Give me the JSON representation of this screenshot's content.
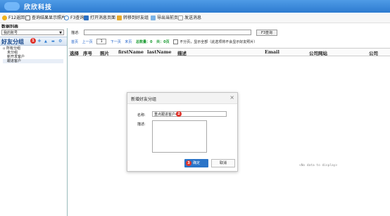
{
  "window": {
    "title": "欣欣科技"
  },
  "toolbar": {
    "items": [
      {
        "label": "F12返回",
        "icon": "smiley-icon",
        "color": "#f0b21c"
      },
      {
        "label": "查询结果显示照片",
        "icon": "checkbox-icon",
        "color": "#ffffff"
      },
      {
        "label": "F3查询",
        "icon": "magnifier-icon",
        "color": "#4a8fd9"
      },
      {
        "label": "打开消息页面",
        "icon": "message-icon",
        "color": "#2c6fc2"
      },
      {
        "label": "转移到好友组",
        "icon": "folder-icon",
        "color": "#e7a92a"
      },
      {
        "label": "导出当前页",
        "icon": "export-icon",
        "color": "#7bb3e6"
      },
      {
        "label": "发送消息",
        "icon": "mail-icon",
        "color": "#cccccc"
      }
    ]
  },
  "section_title": "数据列表",
  "left": {
    "account_select": "我的账号",
    "group_header": "好友分组",
    "badge_1": "1",
    "controls": [
      "+",
      "▲",
      "▬",
      "⚙"
    ],
    "tree": [
      "所有分组",
      "未分组",
      "新开发客户",
      "跟进客户"
    ]
  },
  "search": {
    "label": "描述:",
    "button": "F3查询"
  },
  "pager": {
    "first": "首页",
    "prev": "上一页",
    "page": "1",
    "next": "下一页",
    "last": "末页",
    "total": "总数量：0",
    "pages": "共：0页",
    "option": "不分页，显示全部（此选项将不会显示好友照片）"
  },
  "grid": {
    "columns": [
      "选择",
      "序号",
      "照片",
      "firstName",
      "lastName",
      "描述",
      "Email",
      "公司网站",
      "公司"
    ],
    "empty_text": "<No data to display>"
  },
  "dialog": {
    "title": "新增好友分组",
    "close": "×",
    "name_label": "名称:",
    "name_value": "重点跟进客户4",
    "desc_label": "描述:",
    "badge_2": "2",
    "badge_3": "3",
    "ok": "确定",
    "cancel": "取消"
  },
  "colors": {
    "accent": "#2b74c8",
    "badge": "#e0342c",
    "group_header_text": "#13458a"
  }
}
